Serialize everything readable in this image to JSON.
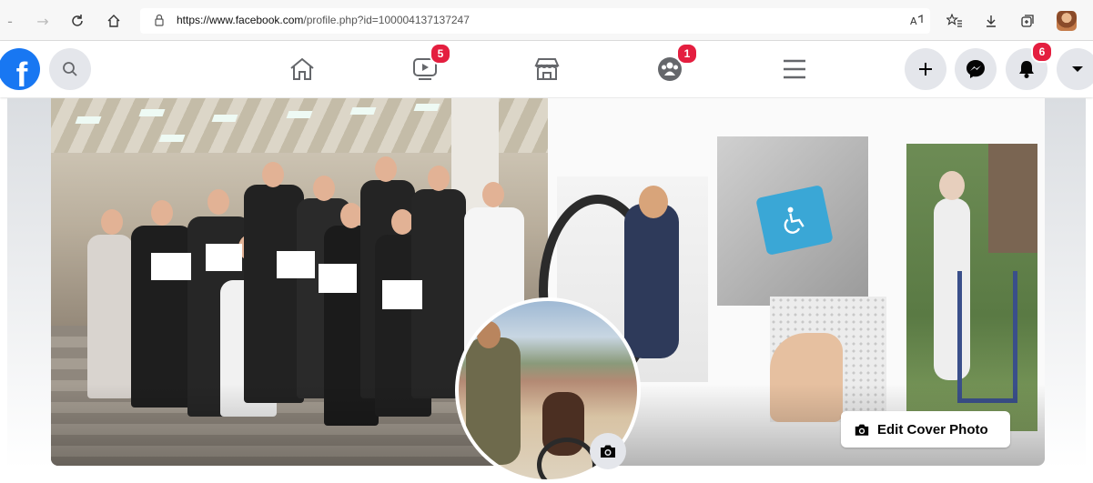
{
  "browser": {
    "url_domain": "https://www.facebook.com",
    "url_path": "/profile.php?id=100004137137247"
  },
  "nav": {
    "logo": "f",
    "badges": {
      "watch": "5",
      "groups": "1",
      "notifications": "6"
    }
  },
  "cover": {
    "edit_label": "Edit Cover Photo"
  },
  "colors": {
    "fb_blue": "#1877f2",
    "badge_red": "#e41e3f",
    "icon_gray": "#65676b"
  }
}
